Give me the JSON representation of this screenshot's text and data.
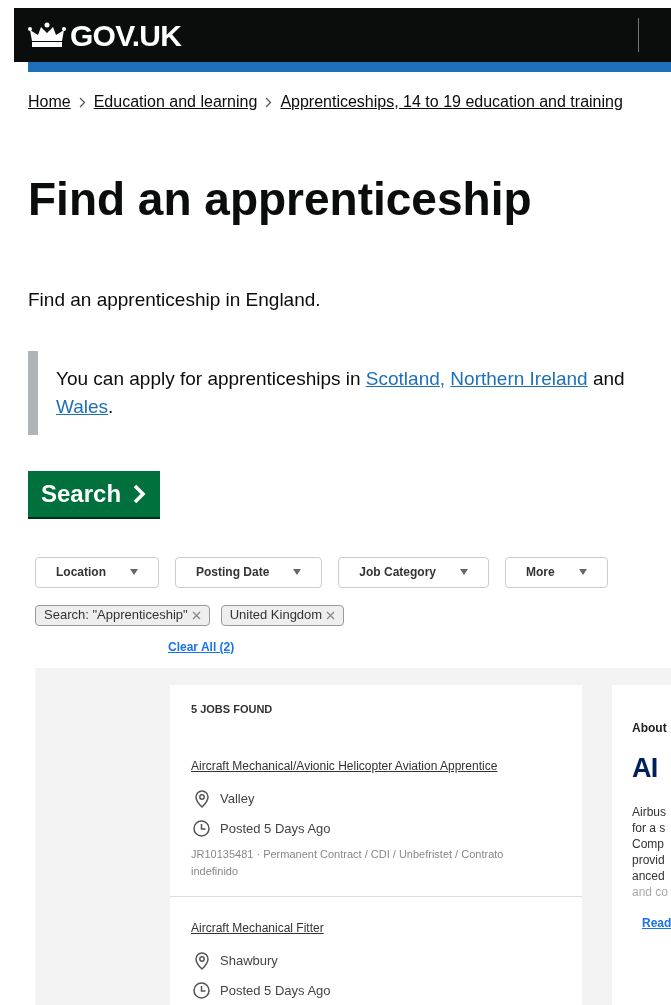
{
  "header": {
    "logo": "GOV.UK"
  },
  "breadcrumbs": [
    "Home",
    "Education and learning",
    "Apprenticeships, 14 to 19 education and training"
  ],
  "title": "Find an apprenticeship",
  "intro": "Find an apprenticeship in England.",
  "inset": [
    {
      "kind": "text",
      "text": "You can apply for apprenticeships in "
    },
    {
      "kind": "link",
      "text": "Scotland,"
    },
    {
      "kind": "gap"
    },
    {
      "kind": "link",
      "text": "Northern Ireland"
    },
    {
      "kind": "text",
      "text": " and "
    },
    {
      "kind": "link",
      "text": "Wales"
    },
    {
      "kind": "text",
      "text": "."
    }
  ],
  "search_button": "Search",
  "filters": [
    {
      "label": "Location"
    },
    {
      "label": "Posting Date"
    },
    {
      "label": "Job Category"
    },
    {
      "label": "More"
    }
  ],
  "chips": [
    {
      "label": "Search: \"Apprenticeship\""
    },
    {
      "label": "United Kingdom"
    }
  ],
  "clear_all": "Clear All (2)",
  "results": {
    "count": "5 JOBS FOUND",
    "jobs": [
      {
        "title": "Aircraft Mechanical/Avionic Helicopter Aviation Apprentice",
        "location": "Valley",
        "posted": "Posted 5 Days Ago",
        "details": "JR10135481 · Permanent Contract / CDI / Unbefristet / Contrato indefinido"
      },
      {
        "title": "Aircraft Mechanical Fitter",
        "location": "Shawbury",
        "posted": "Posted 5 Days Ago"
      }
    ]
  },
  "about": {
    "heading": "About",
    "logo": "AI",
    "lines": [
      "Airbus",
      "for a s",
      "Comp",
      "provid",
      "anced"
    ],
    "faded_line": "and co",
    "link": "Read"
  }
}
